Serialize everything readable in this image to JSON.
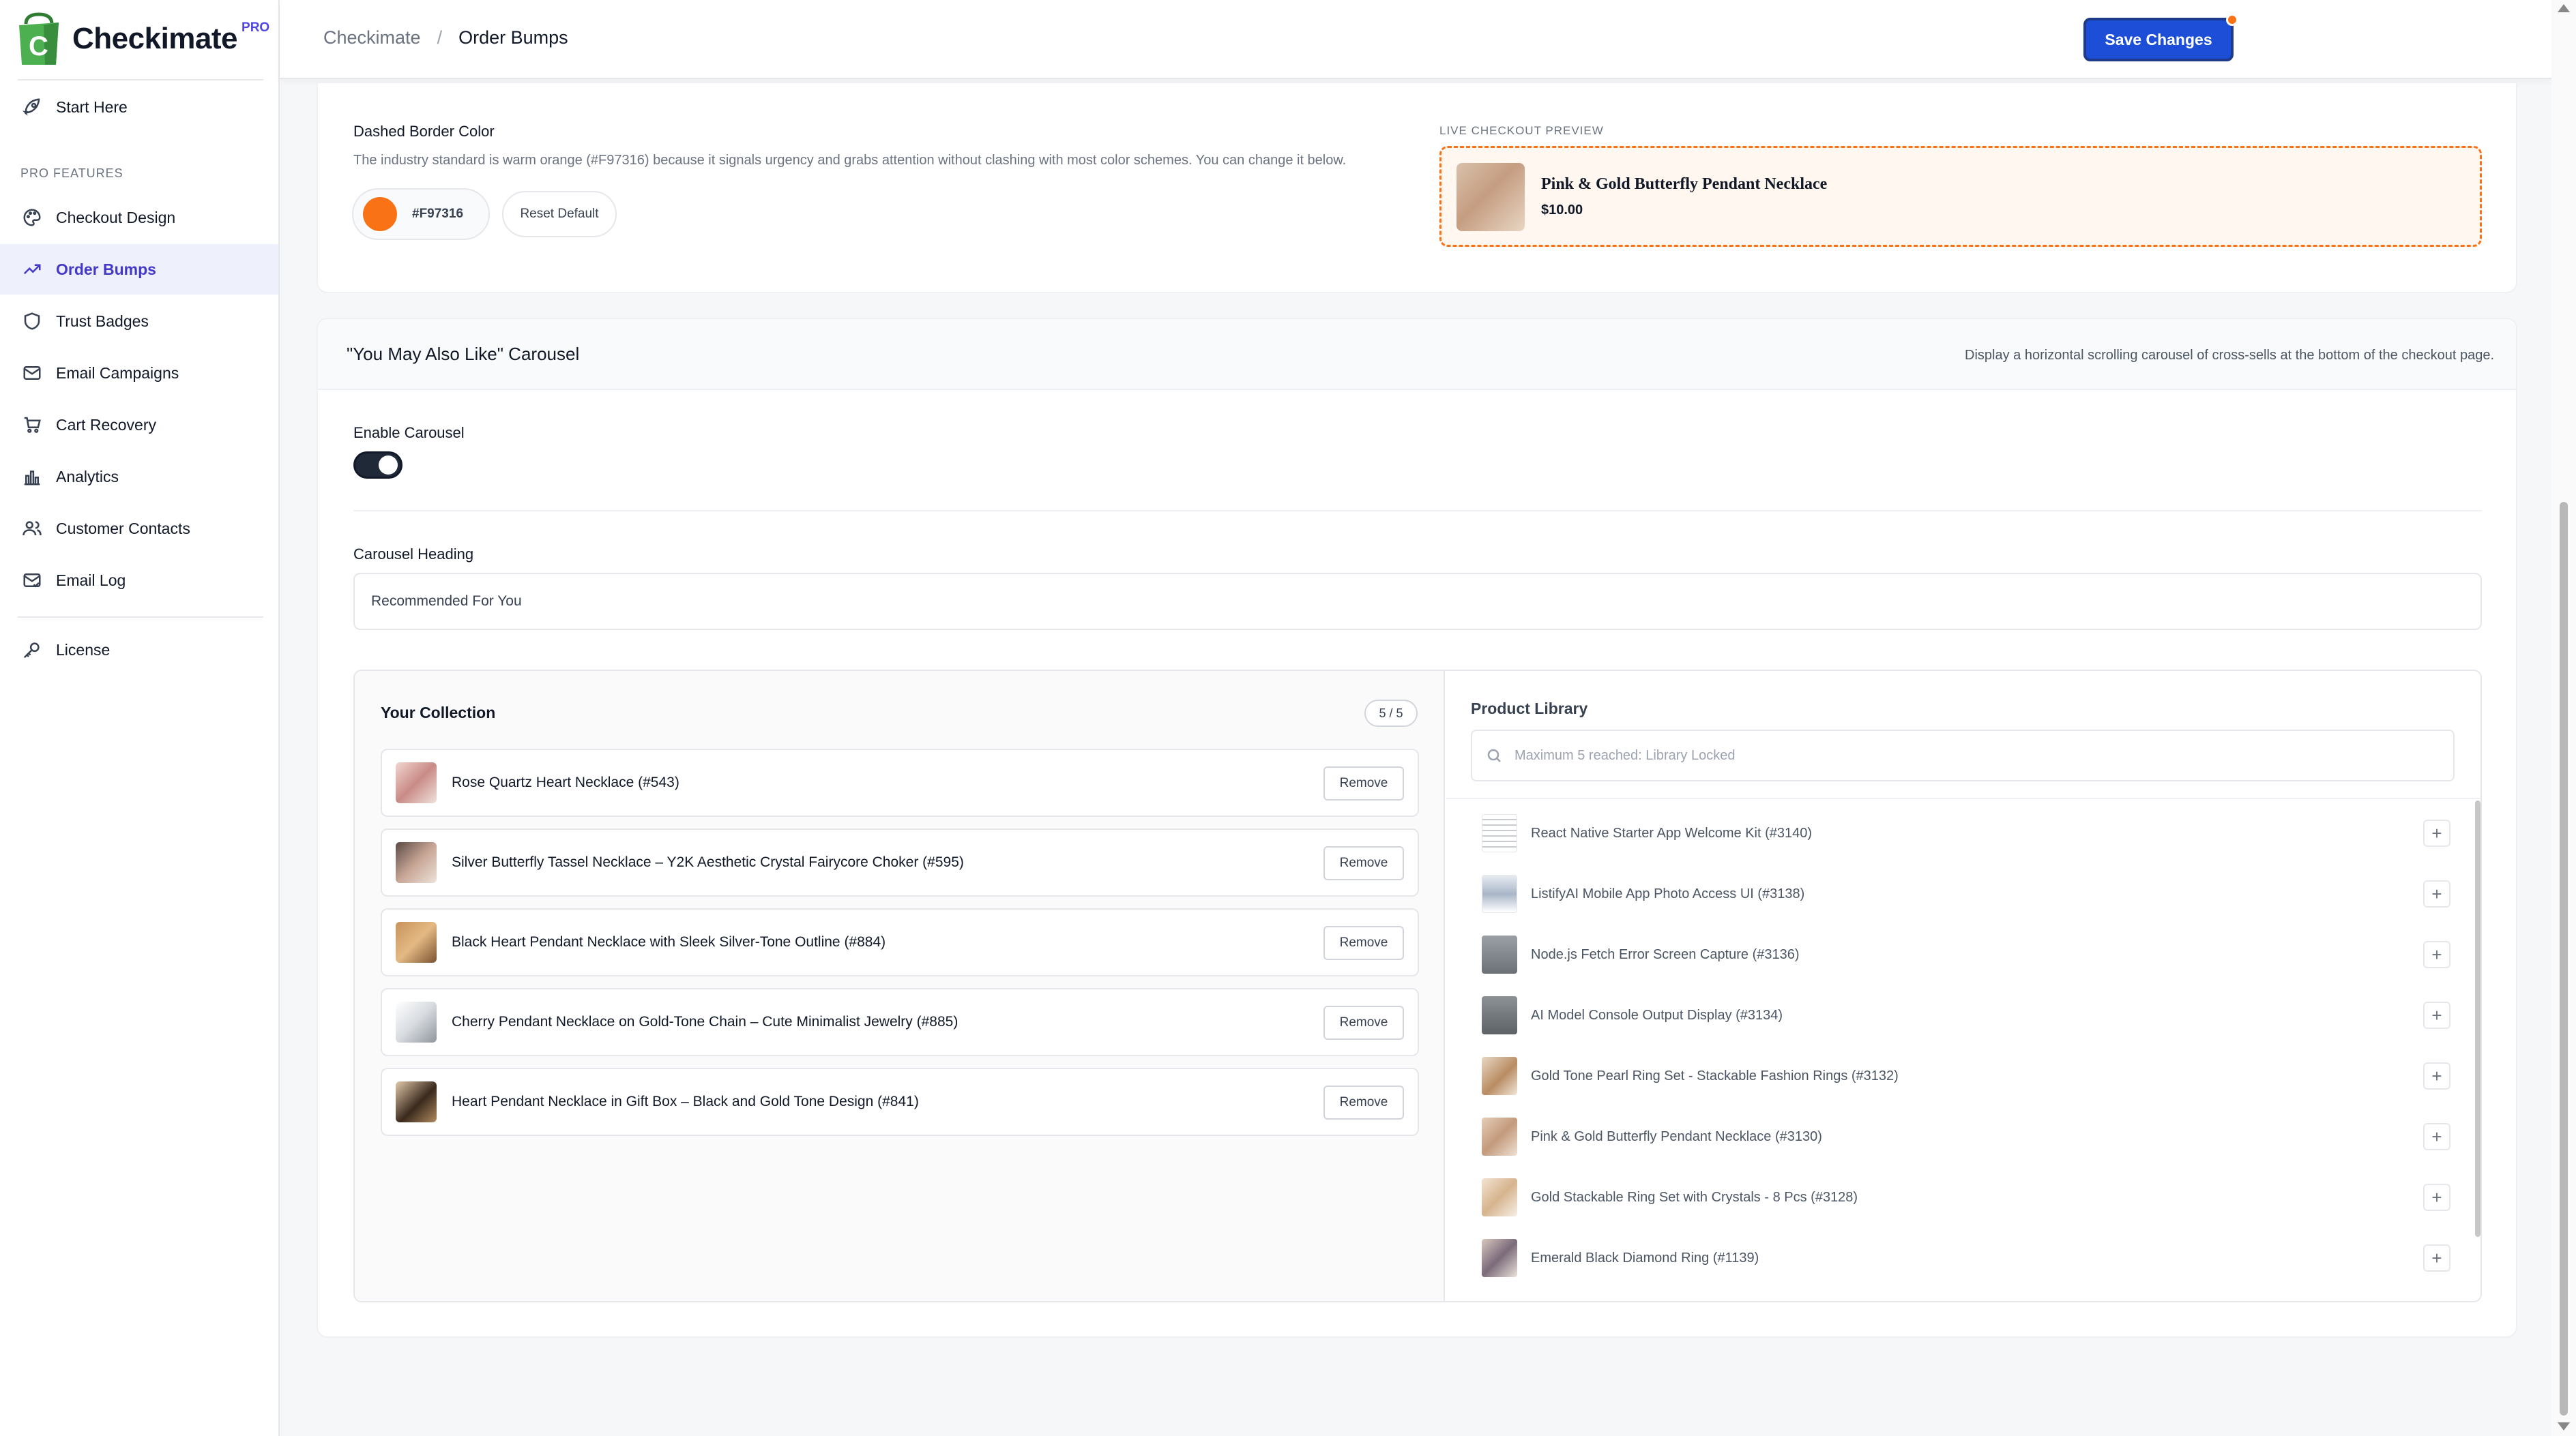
{
  "app": {
    "name": "Checkimate",
    "badge": "PRO"
  },
  "sidebar": {
    "start": "Start Here",
    "section_label": "PRO FEATURES",
    "items": [
      {
        "label": "Checkout Design"
      },
      {
        "label": "Order Bumps"
      },
      {
        "label": "Trust Badges"
      },
      {
        "label": "Email Campaigns"
      },
      {
        "label": "Cart Recovery"
      },
      {
        "label": "Analytics"
      },
      {
        "label": "Customer Contacts"
      },
      {
        "label": "Email Log"
      }
    ],
    "license": "License"
  },
  "topbar": {
    "crumb_root": "Checkimate",
    "crumb_sep": "/",
    "crumb_current": "Order Bumps",
    "save_label": "Save Changes"
  },
  "border_color": {
    "label": "Dashed Border Color",
    "description": "The industry standard is warm orange (#F97316) because it signals urgency and grabs attention without clashing with most color schemes. You can change it below.",
    "hex": "#F97316",
    "reset_label": "Reset Default"
  },
  "preview": {
    "label": "LIVE CHECKOUT PREVIEW",
    "title": "Pink & Gold Butterfly Pendant Necklace",
    "price": "$10.00"
  },
  "carousel": {
    "title": "\"You May Also Like\" Carousel",
    "description": "Display a horizontal scrolling carousel of cross-sells at the bottom of the checkout page.",
    "enable_label": "Enable Carousel",
    "enabled": true,
    "heading_label": "Carousel Heading",
    "heading_value": "Recommended For You"
  },
  "collection": {
    "title": "Your Collection",
    "count": "5 / 5",
    "remove_label": "Remove",
    "items": [
      {
        "name": "Rose Quartz Heart Necklace (#543)"
      },
      {
        "name": "Silver Butterfly Tassel Necklace – Y2K Aesthetic Crystal Fairycore Choker (#595)"
      },
      {
        "name": "Black Heart Pendant Necklace with Sleek Silver-Tone Outline (#884)"
      },
      {
        "name": "Cherry Pendant Necklace on Gold-Tone Chain – Cute Minimalist Jewelry (#885)"
      },
      {
        "name": "Heart Pendant Necklace in Gift Box – Black and Gold Tone Design (#841)"
      }
    ]
  },
  "library": {
    "title": "Product Library",
    "search_placeholder": "Maximum 5 reached: Library Locked",
    "add_label": "+",
    "items": [
      {
        "name": "React Native Starter App Welcome Kit (#3140)"
      },
      {
        "name": "ListifyAI Mobile App Photo Access UI (#3138)"
      },
      {
        "name": "Node.js Fetch Error Screen Capture (#3136)"
      },
      {
        "name": "AI Model Console Output Display (#3134)"
      },
      {
        "name": "Gold Tone Pearl Ring Set - Stackable Fashion Rings (#3132)"
      },
      {
        "name": "Pink & Gold Butterfly Pendant Necklace (#3130)"
      },
      {
        "name": "Gold Stackable Ring Set with Crystals - 8 Pcs (#3128)"
      },
      {
        "name": "Emerald Black Diamond Ring (#1139)"
      }
    ]
  },
  "colors": {
    "accent": "#4338CA",
    "primary_button": "#1D4ED8",
    "border_orange": "#F97316",
    "brand_green": "#4CAF50"
  }
}
